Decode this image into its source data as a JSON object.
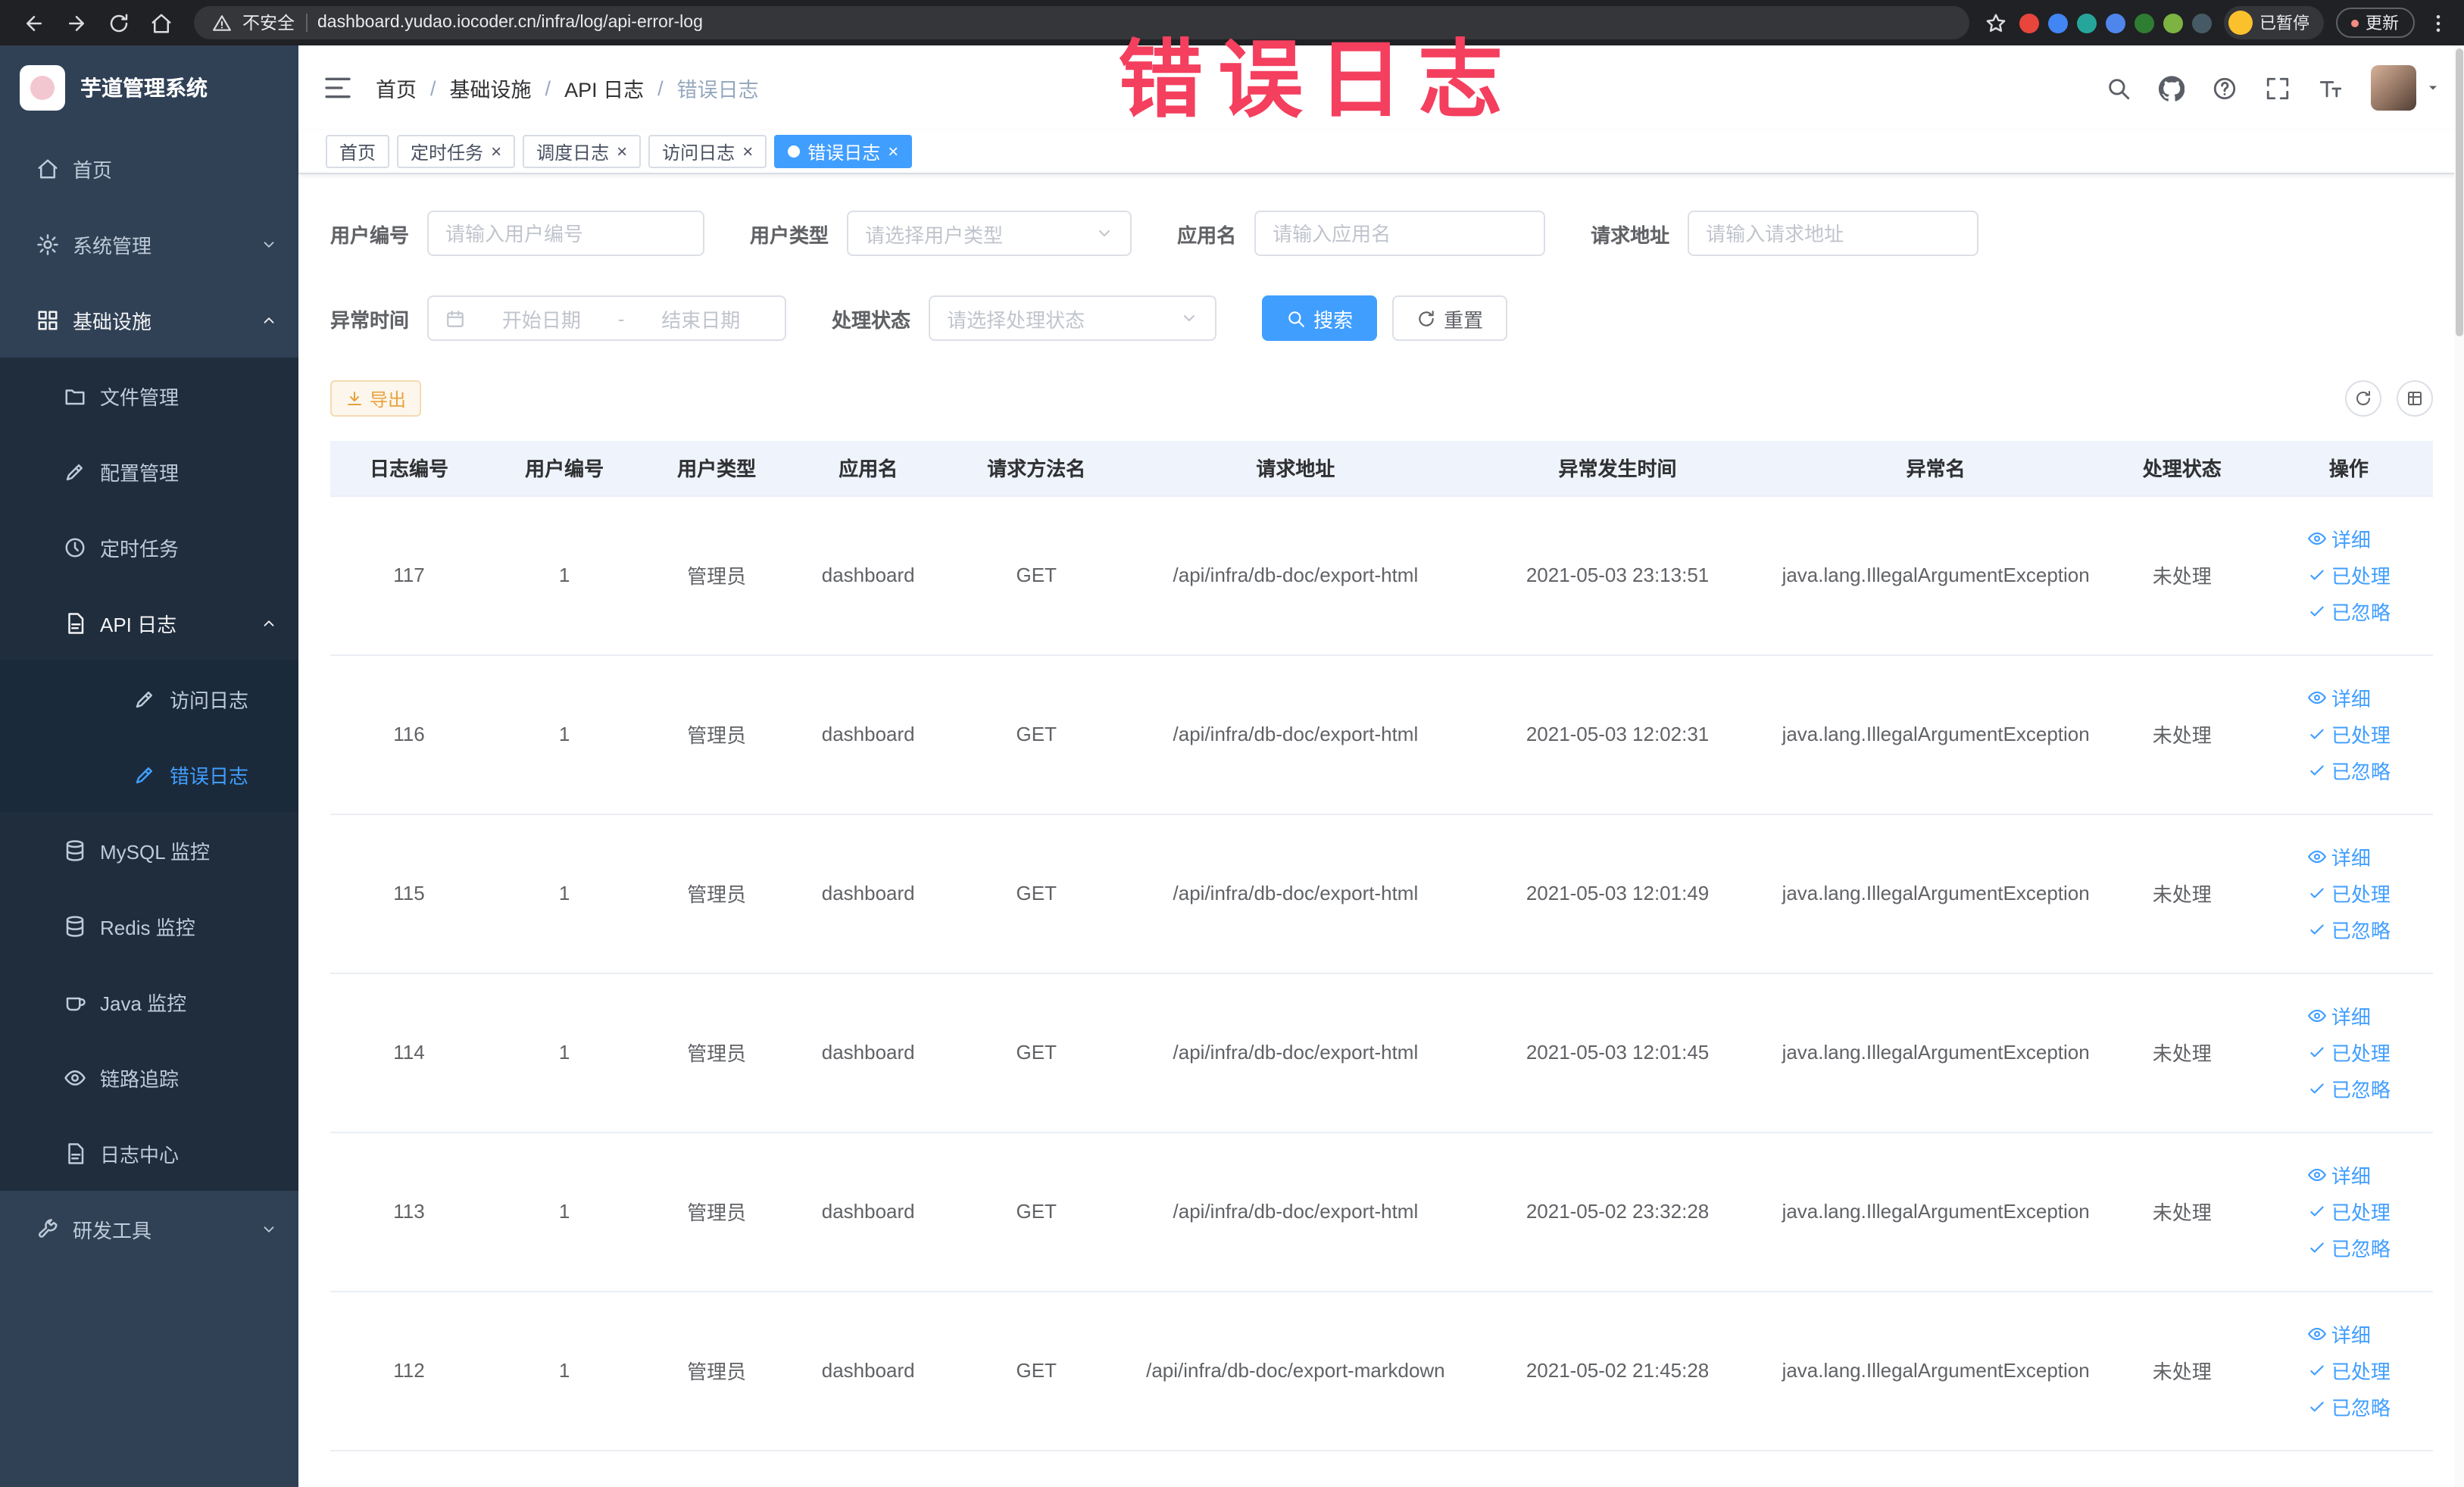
{
  "browser": {
    "security_chip": "不安全",
    "url": "dashboard.yudao.iocoder.cn/infra/log/api-error-log",
    "profile_chip": "已暂停",
    "update_button": "更新",
    "extension_colors": [
      "#e8453c",
      "#4285f4",
      "#26a69a",
      "#4f86ec",
      "#2e7d32",
      "#7cb342",
      "#455a64"
    ]
  },
  "annotation": {
    "text": "错误日志",
    "color": "#f43f5e"
  },
  "sidebar": {
    "logo_title": "芋道管理系统",
    "items": [
      {
        "label": "首页",
        "icon": "home-icon",
        "level": 1
      },
      {
        "label": "系统管理",
        "icon": "gear-icon",
        "level": 1,
        "expandable": true,
        "expanded": false
      },
      {
        "label": "基础设施",
        "icon": "grid-icon",
        "level": 1,
        "expandable": true,
        "expanded": true,
        "open": true
      },
      {
        "label": "文件管理",
        "icon": "folder-icon",
        "level": 2
      },
      {
        "label": "配置管理",
        "icon": "edit-icon",
        "level": 2
      },
      {
        "label": "定时任务",
        "icon": "clock-icon",
        "level": 2
      },
      {
        "label": "API 日志",
        "icon": "doc-icon",
        "level": 2,
        "expandable": true,
        "expanded": true,
        "open": true
      },
      {
        "label": "访问日志",
        "icon": "edit-icon",
        "level": 3
      },
      {
        "label": "错误日志",
        "icon": "edit-icon",
        "level": 3,
        "active": true
      },
      {
        "label": "MySQL 监控",
        "icon": "db-icon",
        "level": 2
      },
      {
        "label": "Redis 监控",
        "icon": "db-icon",
        "level": 2
      },
      {
        "label": "Java 监控",
        "icon": "cup-icon",
        "level": 2
      },
      {
        "label": "链路追踪",
        "icon": "eye-icon",
        "level": 2
      },
      {
        "label": "日志中心",
        "icon": "doc-icon",
        "level": 2
      },
      {
        "label": "研发工具",
        "icon": "wrench-icon",
        "level": 1,
        "expandable": true,
        "expanded": false
      }
    ]
  },
  "header": {
    "breadcrumb": [
      "首页",
      "基础设施",
      "API 日志",
      "错误日志"
    ],
    "separator": "/"
  },
  "tabs": [
    {
      "label": "首页",
      "closable": false,
      "active": false
    },
    {
      "label": "定时任务",
      "closable": true,
      "active": false
    },
    {
      "label": "调度日志",
      "closable": true,
      "active": false
    },
    {
      "label": "访问日志",
      "closable": true,
      "active": false
    },
    {
      "label": "错误日志",
      "closable": true,
      "active": true
    }
  ],
  "ui": {
    "close_glyph": "×"
  },
  "filters": {
    "user_id": {
      "label": "用户编号",
      "placeholder": "请输入用户编号"
    },
    "user_type": {
      "label": "用户类型",
      "placeholder": "请选择用户类型"
    },
    "app_name": {
      "label": "应用名",
      "placeholder": "请输入应用名"
    },
    "request_url": {
      "label": "请求地址",
      "placeholder": "请输入请求地址"
    },
    "exception_time": {
      "label": "异常时间",
      "start_placeholder": "开始日期",
      "separator": "-",
      "end_placeholder": "结束日期"
    },
    "process_status": {
      "label": "处理状态",
      "placeholder": "请选择处理状态"
    },
    "search_button": "搜索",
    "reset_button": "重置"
  },
  "toolbar": {
    "export_button": "导出"
  },
  "table": {
    "columns": [
      "日志编号",
      "用户编号",
      "用户类型",
      "应用名",
      "请求方法名",
      "请求地址",
      "异常发生时间",
      "异常名",
      "处理状态",
      "操作"
    ],
    "rows": [
      {
        "id": "117",
        "user_id": "1",
        "user_type": "管理员",
        "app": "dashboard",
        "method": "GET",
        "url": "/api/infra/db-doc/export-html",
        "time": "2021-05-03 23:13:51",
        "exception": "java.lang.IllegalArgumentException",
        "status": "未处理"
      },
      {
        "id": "116",
        "user_id": "1",
        "user_type": "管理员",
        "app": "dashboard",
        "method": "GET",
        "url": "/api/infra/db-doc/export-html",
        "time": "2021-05-03 12:02:31",
        "exception": "java.lang.IllegalArgumentException",
        "status": "未处理"
      },
      {
        "id": "115",
        "user_id": "1",
        "user_type": "管理员",
        "app": "dashboard",
        "method": "GET",
        "url": "/api/infra/db-doc/export-html",
        "time": "2021-05-03 12:01:49",
        "exception": "java.lang.IllegalArgumentException",
        "status": "未处理"
      },
      {
        "id": "114",
        "user_id": "1",
        "user_type": "管理员",
        "app": "dashboard",
        "method": "GET",
        "url": "/api/infra/db-doc/export-html",
        "time": "2021-05-03 12:01:45",
        "exception": "java.lang.IllegalArgumentException",
        "status": "未处理"
      },
      {
        "id": "113",
        "user_id": "1",
        "user_type": "管理员",
        "app": "dashboard",
        "method": "GET",
        "url": "/api/infra/db-doc/export-html",
        "time": "2021-05-02 23:32:28",
        "exception": "java.lang.IllegalArgumentException",
        "status": "未处理"
      },
      {
        "id": "112",
        "user_id": "1",
        "user_type": "管理员",
        "app": "dashboard",
        "method": "GET",
        "url": "/api/infra/db-doc/export-markdown",
        "time": "2021-05-02 21:45:28",
        "exception": "java.lang.IllegalArgumentException",
        "status": "未处理"
      }
    ],
    "row_actions": [
      {
        "label": "详细",
        "icon": "view-icon",
        "name": "detail-link"
      },
      {
        "label": "已处理",
        "icon": "check-icon",
        "name": "processed-link"
      },
      {
        "label": "已忽略",
        "icon": "check-icon",
        "name": "ignored-link"
      }
    ]
  }
}
